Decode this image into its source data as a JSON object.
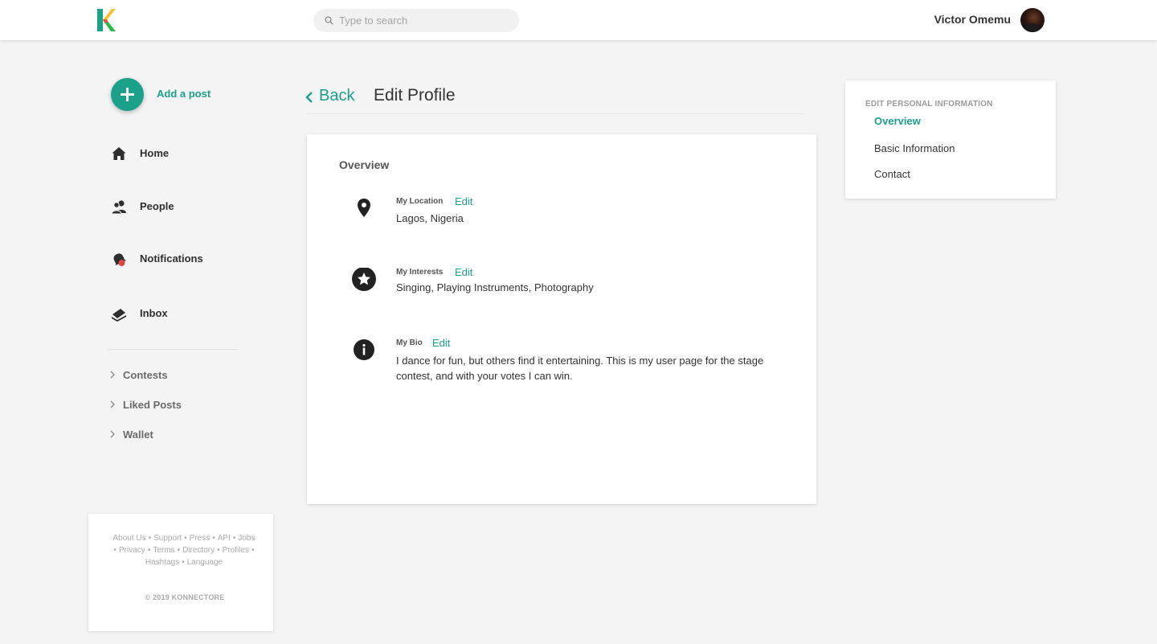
{
  "header": {
    "search_placeholder": "Type to search",
    "user_name": "Victor Omemu"
  },
  "sidebar": {
    "add_post_label": "Add a post",
    "nav": [
      {
        "label": "Home",
        "icon": "home-icon"
      },
      {
        "label": "People",
        "icon": "people-icon"
      },
      {
        "label": "Notifications",
        "icon": "notifications-icon"
      },
      {
        "label": "Inbox",
        "icon": "inbox-icon"
      }
    ],
    "sub": [
      {
        "label": "Contests"
      },
      {
        "label": "Liked Posts"
      },
      {
        "label": "Wallet"
      }
    ]
  },
  "footer": {
    "links": [
      "About Us",
      "Support",
      "Press",
      "API",
      "Jobs",
      "Privacy",
      "Terms",
      "Directory",
      "Profiles",
      "Hashtags",
      "Language"
    ],
    "copyright": "© 2019 KONNECTORE"
  },
  "main": {
    "back_label": "Back",
    "page_title": "Edit Profile",
    "card_heading": "Overview",
    "fields": [
      {
        "label": "My Location",
        "edit": "Edit",
        "value": "Lagos, Nigeria",
        "icon": "location-pin-icon"
      },
      {
        "label": "My Interests",
        "edit": "Edit",
        "value": "Singing, Playing Instruments, Photography",
        "icon": "star-icon"
      },
      {
        "label": "My Bio",
        "edit": "Edit",
        "value": "I dance for fun, but others find it entertaining. This is my user page for the stage contest, and with your votes I can win.",
        "icon": "info-icon"
      }
    ]
  },
  "right_panel": {
    "heading": "EDIT PERSONAL INFORMATION",
    "items": [
      {
        "label": "Overview",
        "active": true
      },
      {
        "label": "Basic Information",
        "active": false
      },
      {
        "label": "Contact",
        "active": false
      }
    ]
  },
  "colors": {
    "accent": "#1ba08a",
    "background": "#f4f4f4",
    "card": "#ffffff"
  }
}
